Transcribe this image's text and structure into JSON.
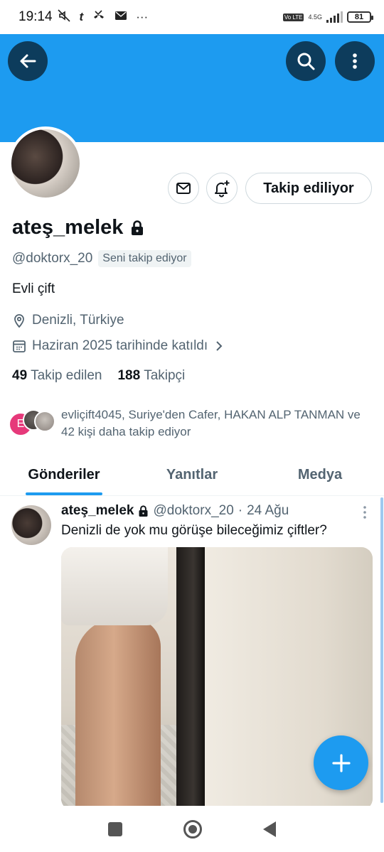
{
  "status_bar": {
    "time": "19:14",
    "network": "4.5G",
    "volte": "Vo LTE",
    "battery": "81",
    "icons": [
      "mute-icon",
      "app-icon",
      "missed-call-icon",
      "mail-icon",
      "more-dots-icon"
    ]
  },
  "header": {
    "banner_color": "#1d9bf0",
    "back_icon": "arrow-left-icon",
    "search_icon": "search-icon",
    "more_icon": "more-vertical-icon"
  },
  "profile": {
    "name": "ateş_melek",
    "handle": "@doktorx_20",
    "follows_you_badge": "Seni takip ediyor",
    "bio": "Evli çift",
    "location": "Denizli, Türkiye",
    "joined": "Haziran 2025 tarihinde katıldı",
    "following_count": "49",
    "following_label": "Takip edilen",
    "followers_count": "188",
    "followers_label": "Takipçi",
    "follow_button": "Takip ediliyor",
    "mutual_followers_text": "evliçift4045, Suriye'den Cafer, HAKAN ALP TANMAN ve 42 kişi daha takip ediyor",
    "mutual_avatar_letter": "E"
  },
  "tabs": [
    {
      "label": "Gönderiler",
      "active": true
    },
    {
      "label": "Yanıtlar",
      "active": false
    },
    {
      "label": "Medya",
      "active": false
    }
  ],
  "tweet": {
    "name": "ateş_melek",
    "handle": "@doktorx_20",
    "separator": "·",
    "date": "24 Ağu",
    "text": "Denizli de yok mu görüşe bileceğimiz çiftler?"
  },
  "fab": {
    "icon": "plus-icon"
  },
  "accent_color": "#1d9bf0"
}
